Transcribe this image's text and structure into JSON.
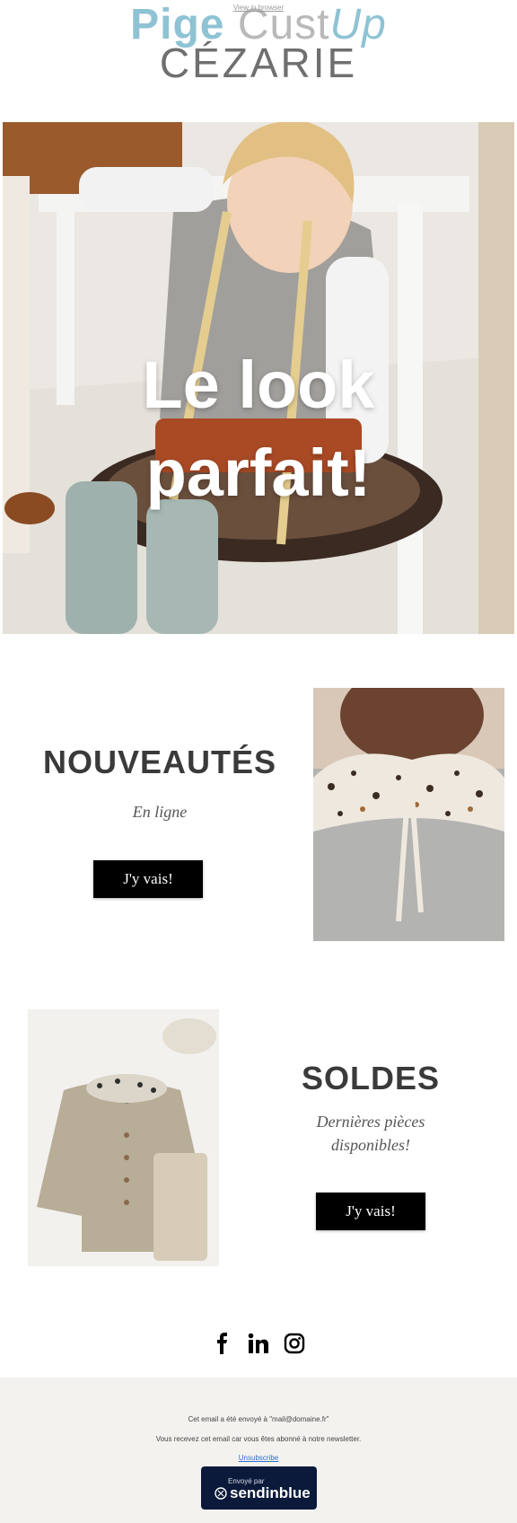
{
  "header": {
    "view_in_browser": "View in browser",
    "logo_part1": "Pige ",
    "logo_part2": "Cust",
    "logo_part3": "Up",
    "logo_bottom": "CÉZARIE"
  },
  "hero": {
    "title_line1": "Le look",
    "title_line2": "parfait!"
  },
  "new_arrivals": {
    "title": "NOUVEAUTÉS",
    "subtitle": "En ligne",
    "button": "J'y vais!"
  },
  "sales": {
    "title": "SOLDES",
    "subtitle_line1": "Dernières pièces",
    "subtitle_line2": "disponibles!",
    "button": "J'y vais!"
  },
  "social": {
    "icons": [
      "facebook-icon",
      "linkedin-icon",
      "instagram-icon"
    ]
  },
  "footer": {
    "line1": "Cet email a été envoyé à \"mail@domaine.fr\"",
    "line2": "Vous recevez cet email car vous êtes abonné à notre newsletter.",
    "unsubscribe": "Unsubscribe",
    "badge_small": "Envoyé par",
    "badge_brand": "sendinblue"
  },
  "colors": {
    "logo_blue": "#8ec3d4",
    "button_bg": "#000000",
    "footer_bg": "#f4f2ee",
    "badge_bg": "#0b1a3b"
  }
}
